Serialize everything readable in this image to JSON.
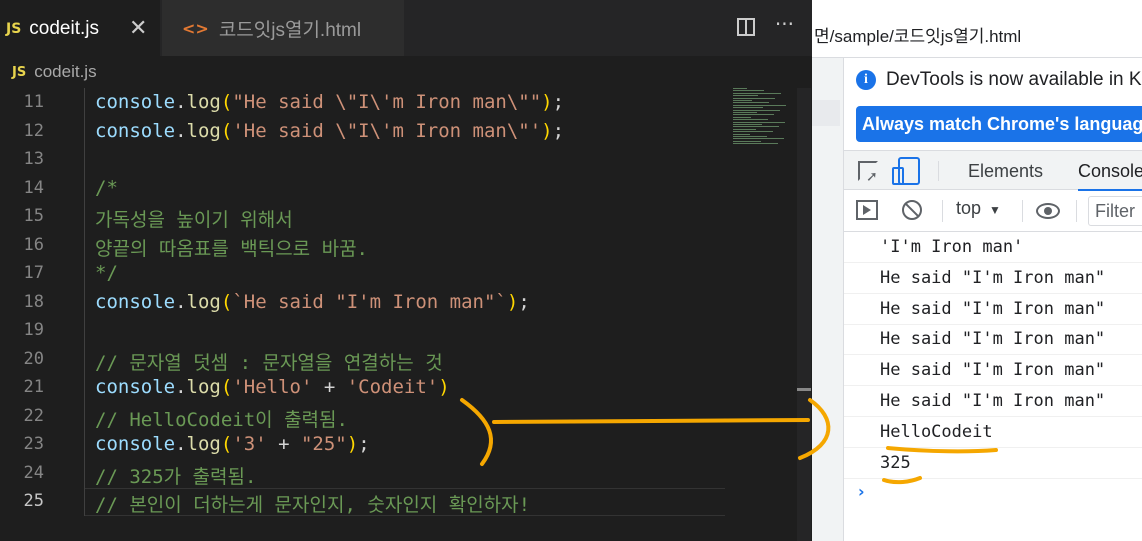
{
  "editor": {
    "active_tab": {
      "badge": "JS",
      "title": "codeit.js",
      "close": "✕"
    },
    "inactive_tab": {
      "icon": "<>",
      "title": "코드잇js열기.html"
    },
    "tab_actions": {
      "more": "···"
    },
    "breadcrumb": {
      "badge": "JS",
      "file": "codeit.js"
    },
    "line_numbers": [
      "11",
      "12",
      "13",
      "14",
      "15",
      "16",
      "17",
      "18",
      "19",
      "20",
      "21",
      "22",
      "23",
      "24",
      "25"
    ],
    "current_line": "25"
  },
  "browser": {
    "url": "면/sample/코드잇js열기.html"
  },
  "devtools": {
    "notice_icon": "i",
    "notice_text": "DevTools is now available in Ko",
    "match_button": "Always match Chrome's language",
    "tabs": {
      "elements": "Elements",
      "console": "Console"
    },
    "toolbar": {
      "context": "top",
      "caret": "▼",
      "filter_placeholder": "Filter"
    },
    "console_logs": [
      "'I'm Iron man'",
      "He said \"I'm Iron man\"",
      "He said \"I'm Iron man\"",
      "He said \"I'm Iron man\"",
      "He said \"I'm Iron man\"",
      "He said \"I'm Iron man\"",
      "HelloCodeit",
      "325"
    ],
    "prompt": "›"
  },
  "colors": {
    "annotation": "#f5a700",
    "accent": "#1a73e8"
  },
  "icons": [
    "close-icon",
    "html-file-icon",
    "split-editor-icon",
    "more-icon",
    "info-icon",
    "inspect-icon",
    "device-toolbar-icon",
    "sidebar-toggle-icon",
    "clear-console-icon",
    "eye-icon"
  ],
  "code_lines": [
    [
      [
        "t-obj",
        "console"
      ],
      [
        "t-op",
        "."
      ],
      [
        "t-fn",
        "log"
      ],
      [
        "t-p1",
        "("
      ],
      [
        "t-str",
        "\"He said \\\"I\\'m Iron man\\\"\""
      ],
      [
        "t-p1",
        ")"
      ],
      [
        "t-op",
        ";"
      ]
    ],
    [
      [
        "t-obj",
        "console"
      ],
      [
        "t-op",
        "."
      ],
      [
        "t-fn",
        "log"
      ],
      [
        "t-p1",
        "("
      ],
      [
        "t-str",
        "'He said \\\"I\\'m Iron man\\\"'"
      ],
      [
        "t-p1",
        ")"
      ],
      [
        "t-op",
        ";"
      ]
    ],
    [],
    [
      [
        "t-com",
        "/*"
      ]
    ],
    [
      [
        "t-com",
        "가독성을 높이기 위해서"
      ]
    ],
    [
      [
        "t-com",
        "양끝의 따옴표를 백틱으로 바꿈."
      ]
    ],
    [
      [
        "t-com",
        "*/"
      ]
    ],
    [
      [
        "t-obj",
        "console"
      ],
      [
        "t-op",
        "."
      ],
      [
        "t-fn",
        "log"
      ],
      [
        "t-p1",
        "("
      ],
      [
        "t-str",
        "`He said \"I'm Iron man\"`"
      ],
      [
        "t-p1",
        ")"
      ],
      [
        "t-op",
        ";"
      ]
    ],
    [],
    [
      [
        "t-com",
        "// 문자열 덧셈 : 문자열을 연결하는 것"
      ]
    ],
    [
      [
        "t-obj",
        "console"
      ],
      [
        "t-op",
        "."
      ],
      [
        "t-fn",
        "log"
      ],
      [
        "t-p1",
        "("
      ],
      [
        "t-str",
        "'Hello'"
      ],
      [
        "t-op",
        " + "
      ],
      [
        "t-str",
        "'Codeit'"
      ],
      [
        "t-p1",
        ")"
      ]
    ],
    [
      [
        "t-com",
        "// HelloCodeit이 출력됨."
      ]
    ],
    [
      [
        "t-obj",
        "console"
      ],
      [
        "t-op",
        "."
      ],
      [
        "t-fn",
        "log"
      ],
      [
        "t-p1",
        "("
      ],
      [
        "t-str",
        "'3'"
      ],
      [
        "t-op",
        " + "
      ],
      [
        "t-str",
        "\"25\""
      ],
      [
        "t-p1",
        ")"
      ],
      [
        "t-op",
        ";"
      ]
    ],
    [
      [
        "t-com",
        "// 325가 출력됨."
      ]
    ],
    [
      [
        "t-com",
        "// 본인이 더하는게 문자인지, 숫자인지 확인하자!"
      ]
    ]
  ]
}
